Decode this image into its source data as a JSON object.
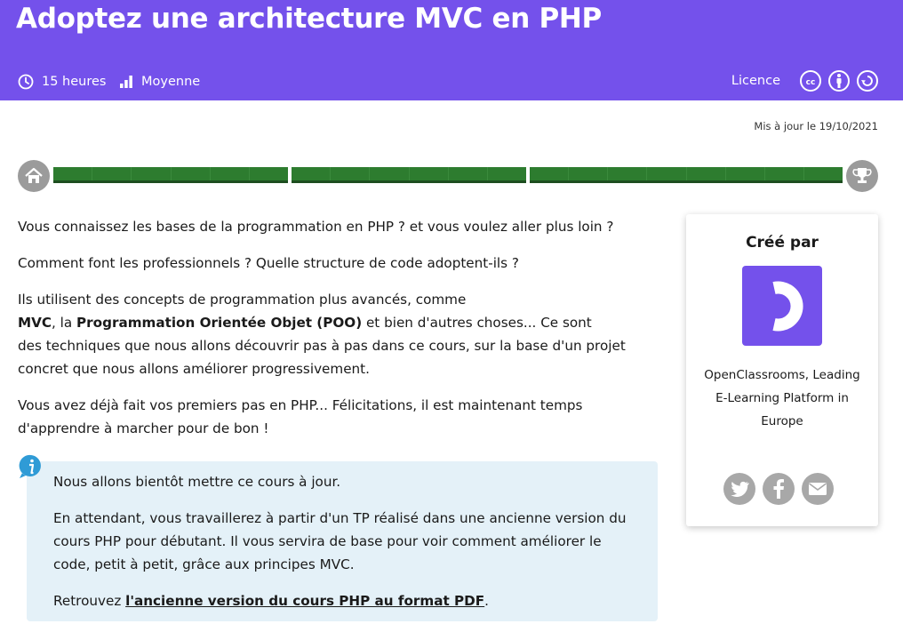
{
  "course": {
    "title": "Adoptez une architecture MVC en PHP",
    "duration": "15 heures",
    "difficulty": "Moyenne",
    "licence_label": "Licence",
    "updated": "Mis à jour le 19/10/2021"
  },
  "progress": {
    "completed_sections": 3,
    "total_sections": 3,
    "section_ticks": [
      6,
      6,
      8
    ]
  },
  "intro": {
    "p1": "Vous connaissez les bases de la programmation en PHP ? et vous voulez aller plus loin ?",
    "p2": "Comment font les professionnels ? Quelle structure de code adoptent-ils ?",
    "p3_a": "Ils utilisent des concepts de programmation plus avancés, comme",
    "p3_b1": "MVC",
    "p3_b2": ", la ",
    "p3_b3": "Programmation Orientée Objet (POO)",
    "p3_b4": " et bien d'autres choses... Ce sont",
    "p3_c": "des techniques que nous allons découvrir pas à pas dans ce cours, sur la base d'un projet",
    "p3_d": "concret que nous allons améliorer progressivement.",
    "p4_a": "Vous avez déjà fait vos premiers pas en PHP... Félicitations, il est maintenant temps",
    "p4_b": "d'apprendre à marcher pour de bon !"
  },
  "callout": {
    "p1": "Nous allons bientôt mettre ce cours à jour.",
    "p2_a": "En attendant, vous travaillerez à partir d'un TP réalisé dans une ancienne version du",
    "p2_b": "cours PHP pour débutant. Il vous servira de base pour voir comment améliorer le",
    "p2_c": "code, petit à petit, grâce aux principes MVC.",
    "p3_prefix": "Retrouvez ",
    "p3_link": "l'ancienne version du cours PHP au format PDF",
    "p3_suffix": "."
  },
  "author": {
    "title": "Créé par",
    "name_l1": "OpenClassrooms, Leading",
    "name_l2": "E-Learning Platform in",
    "name_l3": "Europe"
  },
  "icons": {
    "clock": "clock-icon",
    "level": "level-bars-icon",
    "cc": "creative-commons-icon",
    "by": "attribution-icon",
    "sa": "share-alike-icon",
    "home": "home-icon",
    "trophy": "trophy-icon",
    "info": "info-icon",
    "twitter": "twitter-icon",
    "facebook": "facebook-icon",
    "email": "email-icon"
  },
  "colors": {
    "brand": "#7451eb",
    "progress": "#2d7c2f",
    "callout_bg": "#e4f1f8",
    "share_grey": "#a8a8a8"
  }
}
